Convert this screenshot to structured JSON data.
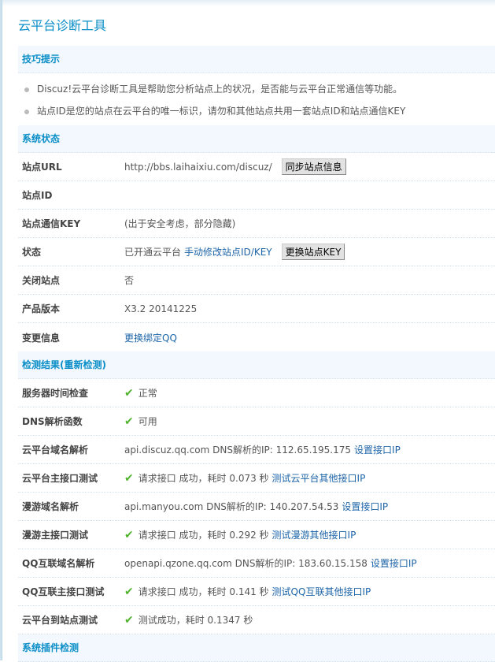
{
  "title": "云平台诊断工具",
  "tips": {
    "header": "技巧提示",
    "items": [
      "Discuz!云平台诊断工具是帮助您分析站点上的状况，是否能与云平台正常通信等功能。",
      "站点ID是您的站点在云平台的唯一标识，请勿和其他站点共用一套站点ID和站点通信KEY"
    ]
  },
  "status": {
    "header": "系统状态",
    "url_label": "站点URL",
    "url": "http://bbs.laihaixiu.com/discuz/",
    "sync_button": "同步站点信息",
    "id_label": "站点ID",
    "key_label": "站点通信KEY",
    "key_value": "(出于安全考虑，部分隐藏)",
    "state_label": "状态",
    "state_value": "已开通云平台",
    "state_link": "手动修改站点ID/KEY",
    "change_key_button": "更换站点KEY",
    "closed_label": "关闭站点",
    "closed_value": "否",
    "version_label": "产品版本",
    "version_value": "X3.2 20141225",
    "change_label": "变更信息",
    "change_link": "更换绑定QQ"
  },
  "results": {
    "header": "检测结果",
    "recheck": "(重新检测)",
    "rows": [
      {
        "label": "服务器时间检查",
        "text": "正常"
      },
      {
        "label": "DNS解析函数",
        "text": "可用"
      },
      {
        "label": "云平台域名解析",
        "text": "api.discuz.qq.com DNS解析的IP: 112.65.195.175",
        "link": "设置接口IP"
      },
      {
        "label": "云平台主接口测试",
        "text": "请求接口 成功，耗时 0.073 秒",
        "link": "测试云平台其他接口IP"
      },
      {
        "label": "漫游域名解析",
        "text": "api.manyou.com DNS解析的IP: 140.207.54.53",
        "link": "设置接口IP"
      },
      {
        "label": "漫游主接口测试",
        "text": "请求接口 成功，耗时 0.292 秒",
        "link": "测试漫游其他接口IP"
      },
      {
        "label": "QQ互联域名解析",
        "text": "openapi.qzone.qq.com DNS解析的IP: 183.60.15.158",
        "link": "设置接口IP"
      },
      {
        "label": "QQ互联主接口测试",
        "text": "请求接口 成功，耗时 0.141 秒",
        "link": "测试QQ互联其他接口IP"
      },
      {
        "label": "云平台到站点测试",
        "text": "测试成功，耗时 0.1347 秒"
      }
    ]
  },
  "plugins": {
    "header": "系统插件检测"
  },
  "icons": {
    "check": "check-icon",
    "bullet": "bullet-icon"
  },
  "colors": {
    "header": "#0b8ec8",
    "link": "#1d64a8",
    "check": "#4fb32d",
    "header_bg": "#f2f8fd"
  }
}
